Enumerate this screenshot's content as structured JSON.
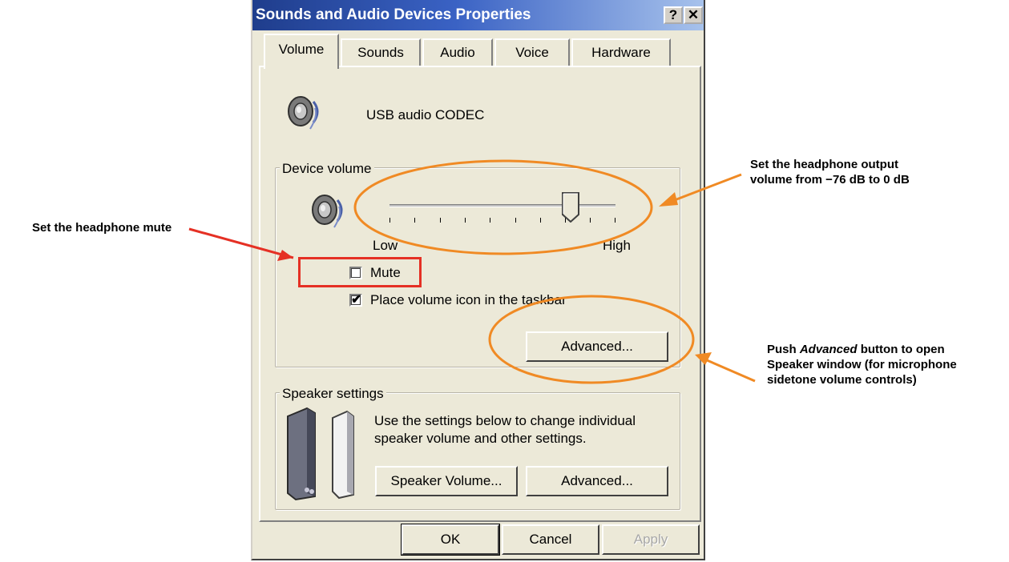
{
  "dialog": {
    "title": "Sounds and Audio Devices Properties",
    "help_btn": "?",
    "close_btn": "✕",
    "tabs": [
      {
        "label": "Volume",
        "active": true
      },
      {
        "label": "Sounds",
        "active": false
      },
      {
        "label": "Audio",
        "active": false
      },
      {
        "label": "Voice",
        "active": false
      },
      {
        "label": "Hardware",
        "active": false
      }
    ],
    "device_name": "USB audio CODEC",
    "device_volume": {
      "legend": "Device volume",
      "low_label": "Low",
      "high_label": "High",
      "slider_level_fraction": 0.8,
      "mute_label": "Mute",
      "mute_checked": false,
      "taskbar_label": "Place volume icon in the taskbar",
      "taskbar_checked": true,
      "advanced_label": "Advanced..."
    },
    "speaker_settings": {
      "legend": "Speaker settings",
      "description_line1": "Use the settings below to change individual",
      "description_line2": "speaker volume and other settings.",
      "speaker_volume_label": "Speaker Volume...",
      "advanced_label": "Advanced..."
    },
    "footer": {
      "ok_label": "OK",
      "cancel_label": "Cancel",
      "apply_label": "Apply"
    }
  },
  "annotations": {
    "mute_note": "Set the headphone mute",
    "volume_note_line1": "Set the headphone output",
    "volume_note_line2": "volume from −76 dB to 0 dB",
    "advanced_note_line1_pre": "Push ",
    "advanced_note_line1_em": "Advanced",
    "advanced_note_line1_post": " button to open",
    "advanced_note_line2": "Speaker window (for microphone",
    "advanced_note_line3": "sidetone volume controls)",
    "colors": {
      "red": "#e53024",
      "orange": "#f08a24"
    }
  },
  "icons": {
    "device": "speaker-icon",
    "volume": "speaker-icon",
    "speakers": "desktop-speakers-icon",
    "checkmark": "✔"
  }
}
